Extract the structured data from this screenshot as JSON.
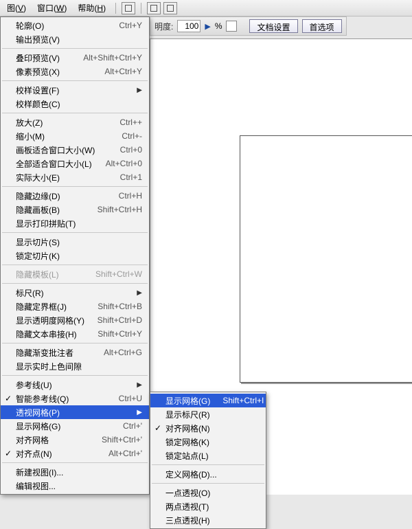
{
  "menubar": {
    "items": [
      {
        "label": "图",
        "key": "V"
      },
      {
        "label": "窗口",
        "key": "W"
      },
      {
        "label": "帮助",
        "key": "H"
      }
    ]
  },
  "toolbar": {
    "opacity_label": "明度:",
    "opacity_value": "100",
    "percent": "%",
    "doc_setup": "文档设置",
    "preferences": "首选项"
  },
  "menu_main": [
    {
      "t": "row",
      "label": "轮廓(O)",
      "shortcut": "Ctrl+Y"
    },
    {
      "t": "row",
      "label": "输出预览(V)"
    },
    {
      "t": "sep"
    },
    {
      "t": "row",
      "label": "叠印预览(V)",
      "shortcut": "Alt+Shift+Ctrl+Y"
    },
    {
      "t": "row",
      "label": "像素预览(X)",
      "shortcut": "Alt+Ctrl+Y"
    },
    {
      "t": "sep"
    },
    {
      "t": "row",
      "label": "校样设置(F)",
      "submenu": true
    },
    {
      "t": "row",
      "label": "校样颜色(C)"
    },
    {
      "t": "sep"
    },
    {
      "t": "row",
      "label": "放大(Z)",
      "shortcut": "Ctrl++"
    },
    {
      "t": "row",
      "label": "缩小(M)",
      "shortcut": "Ctrl+-"
    },
    {
      "t": "row",
      "label": "画板适合窗口大小(W)",
      "shortcut": "Ctrl+0"
    },
    {
      "t": "row",
      "label": "全部适合窗口大小(L)",
      "shortcut": "Alt+Ctrl+0"
    },
    {
      "t": "row",
      "label": "实际大小(E)",
      "shortcut": "Ctrl+1"
    },
    {
      "t": "sep"
    },
    {
      "t": "row",
      "label": "隐藏边缘(D)",
      "shortcut": "Ctrl+H"
    },
    {
      "t": "row",
      "label": "隐藏画板(B)",
      "shortcut": "Shift+Ctrl+H"
    },
    {
      "t": "row",
      "label": "显示打印拼贴(T)"
    },
    {
      "t": "sep"
    },
    {
      "t": "row",
      "label": "显示切片(S)"
    },
    {
      "t": "row",
      "label": "锁定切片(K)"
    },
    {
      "t": "sep"
    },
    {
      "t": "row",
      "label": "隐藏模板(L)",
      "shortcut": "Shift+Ctrl+W",
      "disabled": true
    },
    {
      "t": "sep"
    },
    {
      "t": "row",
      "label": "标尺(R)",
      "submenu": true
    },
    {
      "t": "row",
      "label": "隐藏定界框(J)",
      "shortcut": "Shift+Ctrl+B"
    },
    {
      "t": "row",
      "label": "显示透明度网格(Y)",
      "shortcut": "Shift+Ctrl+D"
    },
    {
      "t": "row",
      "label": "隐藏文本串接(H)",
      "shortcut": "Shift+Ctrl+Y"
    },
    {
      "t": "sep"
    },
    {
      "t": "row",
      "label": "隐藏渐变批注者",
      "shortcut": "Alt+Ctrl+G"
    },
    {
      "t": "row",
      "label": "显示实时上色间隙"
    },
    {
      "t": "sep"
    },
    {
      "t": "row",
      "label": "参考线(U)",
      "submenu": true
    },
    {
      "t": "row",
      "label": "智能参考线(Q)",
      "shortcut": "Ctrl+U",
      "check": true
    },
    {
      "t": "row",
      "label": "透视网格(P)",
      "submenu": true,
      "highlight": true
    },
    {
      "t": "row",
      "label": "显示网格(G)",
      "shortcut": "Ctrl+'"
    },
    {
      "t": "row",
      "label": "对齐网格",
      "shortcut": "Shift+Ctrl+'"
    },
    {
      "t": "row",
      "label": "对齐点(N)",
      "shortcut": "Alt+Ctrl+'",
      "check": true
    },
    {
      "t": "sep"
    },
    {
      "t": "row",
      "label": "新建视图(I)..."
    },
    {
      "t": "row",
      "label": "编辑视图..."
    }
  ],
  "menu_sub": [
    {
      "t": "row",
      "label": "显示网格(G)",
      "shortcut": "Shift+Ctrl+I",
      "highlight": true
    },
    {
      "t": "row",
      "label": "显示标尺(R)"
    },
    {
      "t": "row",
      "label": "对齐网格(N)",
      "check": true
    },
    {
      "t": "row",
      "label": "锁定网格(K)"
    },
    {
      "t": "row",
      "label": "锁定站点(L)"
    },
    {
      "t": "sep"
    },
    {
      "t": "row",
      "label": "定义网格(D)..."
    },
    {
      "t": "sep"
    },
    {
      "t": "row",
      "label": "一点透视(O)"
    },
    {
      "t": "row",
      "label": "两点透视(T)"
    },
    {
      "t": "row",
      "label": "三点透视(H)"
    }
  ]
}
